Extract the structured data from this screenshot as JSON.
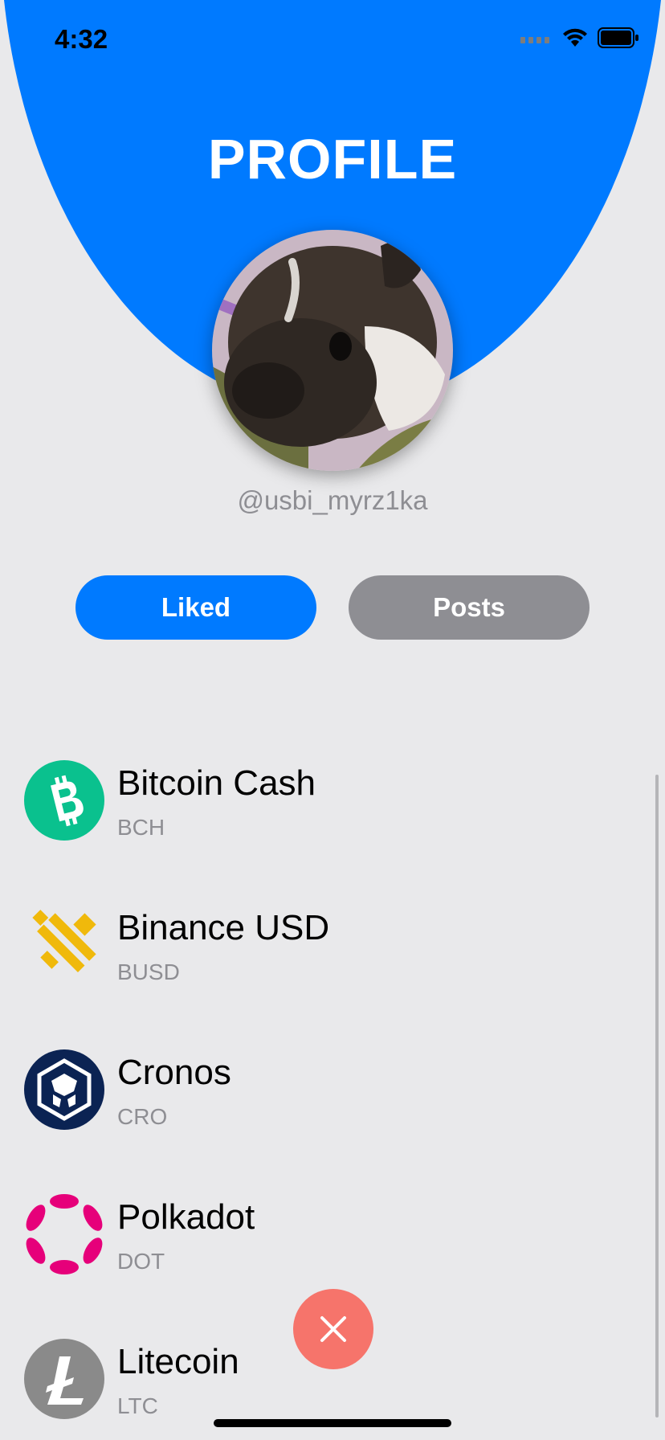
{
  "status_bar": {
    "time": "4:32"
  },
  "header": {
    "title": "PROFILE"
  },
  "profile": {
    "username": "@usbi_myrz1ka"
  },
  "segments": {
    "liked_label": "Liked",
    "posts_label": "Posts",
    "selected": "Liked"
  },
  "colors": {
    "accent": "#007aff",
    "inactive": "#8e8e93",
    "background": "#e9e9eb",
    "close_button": "#f6746b"
  },
  "coins": [
    {
      "name": "Bitcoin Cash",
      "symbol": "BCH",
      "icon": "bitcoin-cash-icon",
      "color": "#0ac18e"
    },
    {
      "name": "Binance USD",
      "symbol": "BUSD",
      "icon": "binance-usd-icon",
      "color": "#f0b90b"
    },
    {
      "name": "Cronos",
      "symbol": "CRO",
      "icon": "cronos-icon",
      "color": "#0b2353"
    },
    {
      "name": "Polkadot",
      "symbol": "DOT",
      "icon": "polkadot-icon",
      "color": "#e6007a"
    },
    {
      "name": "Litecoin",
      "symbol": "LTC",
      "icon": "litecoin-icon",
      "color": "#8a8a8a"
    }
  ],
  "fab": {
    "icon": "close-icon"
  }
}
